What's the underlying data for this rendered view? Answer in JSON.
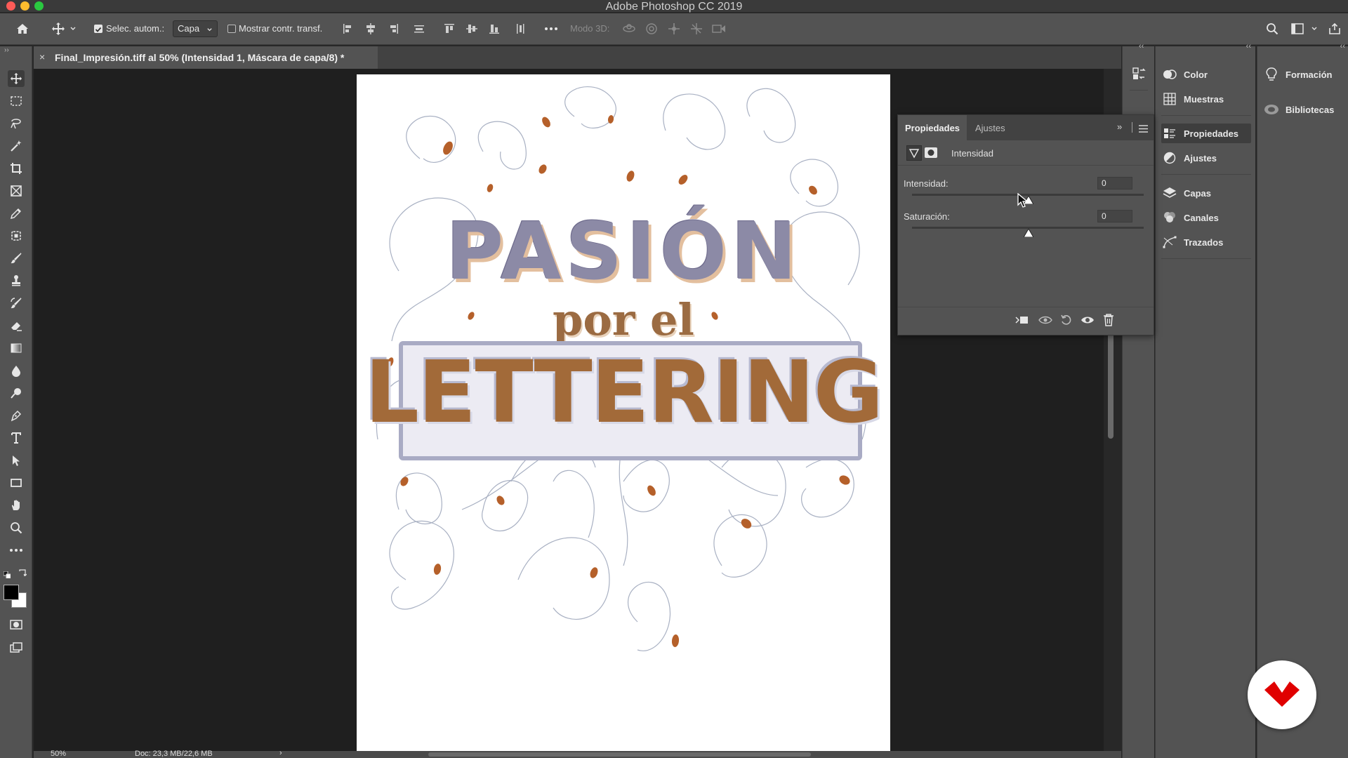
{
  "window": {
    "title": "Adobe Photoshop CC 2019",
    "traffic_lights": [
      "#fd5b57",
      "#fdbc2e",
      "#2ac840"
    ]
  },
  "options_bar": {
    "auto_select_label": "Selec. autom.:",
    "auto_select_checked": true,
    "auto_select_target": "Capa",
    "show_transform_label": "Mostrar contr. transf.",
    "show_transform_checked": false,
    "mode3d_label": "Modo 3D:"
  },
  "document": {
    "tab_title": "Final_Impresión.tiff al 50% (Intensidad 1, Máscara de capa/8) *",
    "zoom": "50%",
    "doc_info": "Doc: 23,3 MB/22,6 MB"
  },
  "artwork": {
    "line1": "PASIÓN",
    "line2": "por el",
    "line3": "LETTERING"
  },
  "properties_panel": {
    "tabs": [
      "Propiedades",
      "Ajustes"
    ],
    "active_tab": "Propiedades",
    "layer_type": "Intensidad",
    "controls": [
      {
        "label": "Intensidad:",
        "value": "0"
      },
      {
        "label": "Saturación:",
        "value": "0"
      }
    ]
  },
  "dock_column_1": {
    "groups": [
      [
        {
          "label": "Color",
          "icon": "color-wheel-icon"
        },
        {
          "label": "Muestras",
          "icon": "swatches-grid-icon"
        }
      ],
      [
        {
          "label": "Propiedades",
          "icon": "properties-icon",
          "active": true
        },
        {
          "label": "Ajustes",
          "icon": "adjustments-icon"
        }
      ],
      [
        {
          "label": "Capas",
          "icon": "layers-icon"
        },
        {
          "label": "Canales",
          "icon": "channels-icon"
        },
        {
          "label": "Trazados",
          "icon": "paths-icon"
        }
      ]
    ]
  },
  "dock_column_2": {
    "items": [
      {
        "label": "Formación",
        "icon": "lightbulb-icon"
      },
      {
        "label": "Bibliotecas",
        "icon": "cc-libraries-icon"
      }
    ]
  },
  "colors": {
    "accent_brand": "#e00000",
    "foreground": "#000000",
    "background": "#ffffff"
  }
}
